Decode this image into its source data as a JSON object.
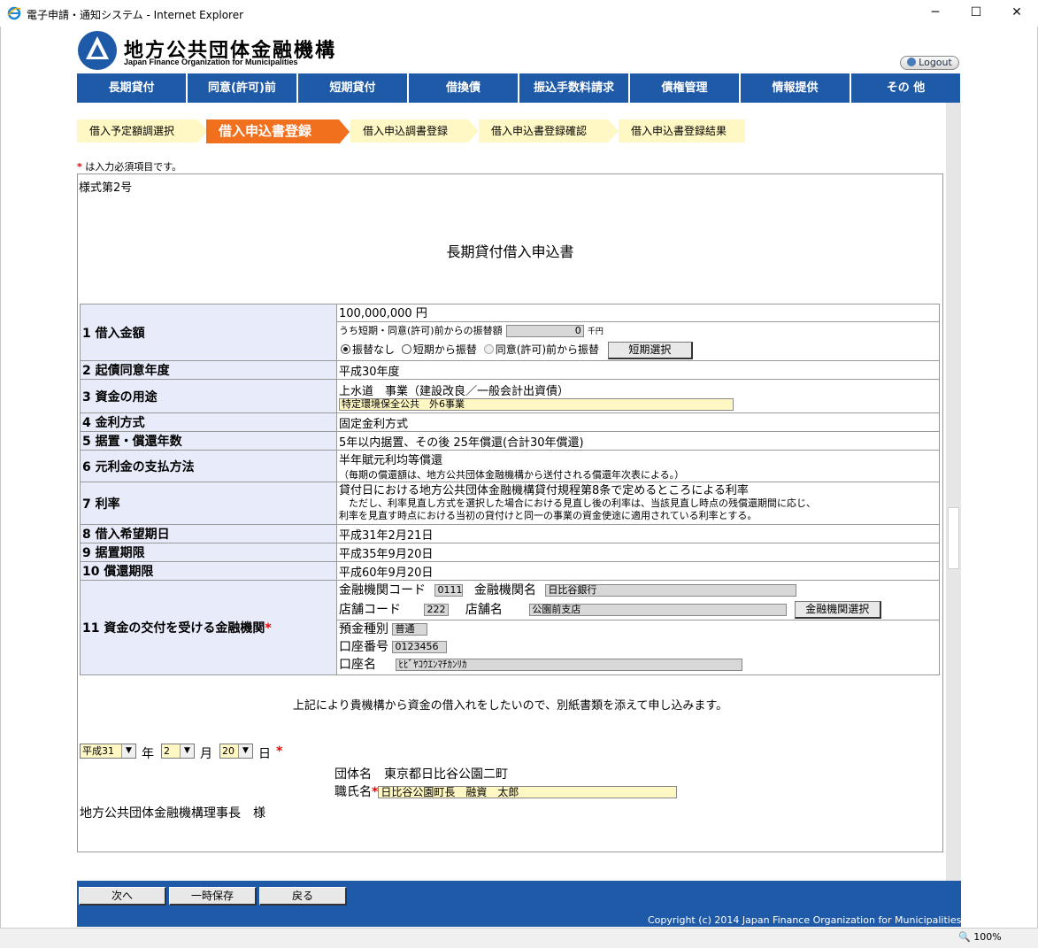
{
  "window": {
    "title": "電子申請・通知システム - Internet Explorer",
    "minimize": "─",
    "maximize": "☐",
    "close": "✕"
  },
  "header": {
    "logo_jp": "地方公共団体金融機構",
    "logo_en": "Japan Finance Organization for Municipalities",
    "logout": "Logout"
  },
  "nav": [
    "長期貸付",
    "同意(許可)前",
    "短期貸付",
    "借換債",
    "振込手数料請求",
    "債権管理",
    "情報提供",
    "その 他"
  ],
  "steps": [
    "借入予定額調選択",
    "借入申込書登録",
    "借入申込調書登録",
    "借入申込書登録確認",
    "借入申込書登録結果"
  ],
  "required_note": "は入力必須項目です。",
  "required_mark": "*",
  "form": {
    "form_no": "様式第2号",
    "title": "長期貸付借入申込書",
    "rows": {
      "amount": {
        "label": "1 借入金額",
        "value": "100,000,000 円",
        "transfer_label": "うち短期・同意(許可)前からの振替額",
        "transfer_value": "0",
        "transfer_unit": "千円",
        "radio_none": "振替なし",
        "radio_short": "短期から振替",
        "radio_consent": "同意(許可)前から振替",
        "short_select_btn": "短期選択"
      },
      "consent_year": {
        "label": "2 起債同意年度",
        "value": "平成30年度"
      },
      "purpose": {
        "label": "3 資金の用途",
        "value": "上水道　事業（建設改良／一般会計出資債）",
        "detail": "特定環境保全公共　外6事業"
      },
      "interest_method": {
        "label": "4 金利方式",
        "value": "固定金利方式"
      },
      "deferment": {
        "label": "5 据置・償還年数",
        "value": "5年以内据置、その後 25年償還(合計30年償還)"
      },
      "repayment": {
        "label": "6 元利金の支払方法",
        "value": "半年賦元利均等償還",
        "note": "（毎期の償還額は、地方公共団体金融機構から送付される償還年次表による。）"
      },
      "rate": {
        "label": "7 利率",
        "line1": "貸付日における地方公共団体金融機構貸付規程第8条で定めるところによる利率",
        "line2": "　ただし、利率見直し方式を選択した場合における見直し後の利率は、当該見直し時点の残償還期間に応じ、",
        "line3": "利率を見直す時点における当初の貸付けと同一の事業の資金使途に適用されている利率とする。"
      },
      "desired_date": {
        "label": "8 借入希望期日",
        "value": "平成31年2月21日"
      },
      "deferment_limit": {
        "label": "9 据置期限",
        "value": "平成35年9月20日"
      },
      "repayment_limit": {
        "label": "10 償還期限",
        "value": "平成60年9月20日"
      },
      "bank": {
        "label": "11 資金の交付を受ける金融機関",
        "bank_code_label": "金融機関コード",
        "bank_code": "0111",
        "bank_name_label": "金融機関名",
        "bank_name": "日比谷銀行",
        "branch_code_label": "店舗コード",
        "branch_code": "222",
        "branch_name_label": "店舗名",
        "branch_name": "公園前支店",
        "bank_select_btn": "金融機関選択",
        "deposit_type_label": "預金種別",
        "deposit_type": "普通",
        "account_no_label": "口座番号",
        "account_no": "0123456",
        "account_name_label": "口座名",
        "account_name": "ﾋﾋﾞﾔｺｳｴﾝﾏﾁｶﾝﾘｶ"
      }
    },
    "declaration": "上記により貴機構から資金の借入れをしたいので、別紙書類を添えて申し込みます。",
    "date": {
      "era": "平成31",
      "year_unit": "年",
      "month": "2",
      "month_unit": "月",
      "day": "20",
      "day_unit": "日"
    },
    "org_label": "団体名",
    "org_value": "東京都日比谷公園二町",
    "name_label": "職氏名",
    "name_value": "日比谷公園町長　融資　太郎",
    "addressee": "地方公共団体金融機構理事長　様"
  },
  "footer": {
    "next": "次へ",
    "save": "一時保存",
    "back": "戻る",
    "copyright": "Copyright (c) 2014 Japan Finance Organization for Municipalities"
  },
  "status": {
    "zoom": "100%"
  },
  "colors": {
    "nav_bg": "#1f5aa8",
    "step_active": "#f0701e",
    "step_bg": "#fff8c4",
    "label_bg": "#e8ecfa"
  }
}
